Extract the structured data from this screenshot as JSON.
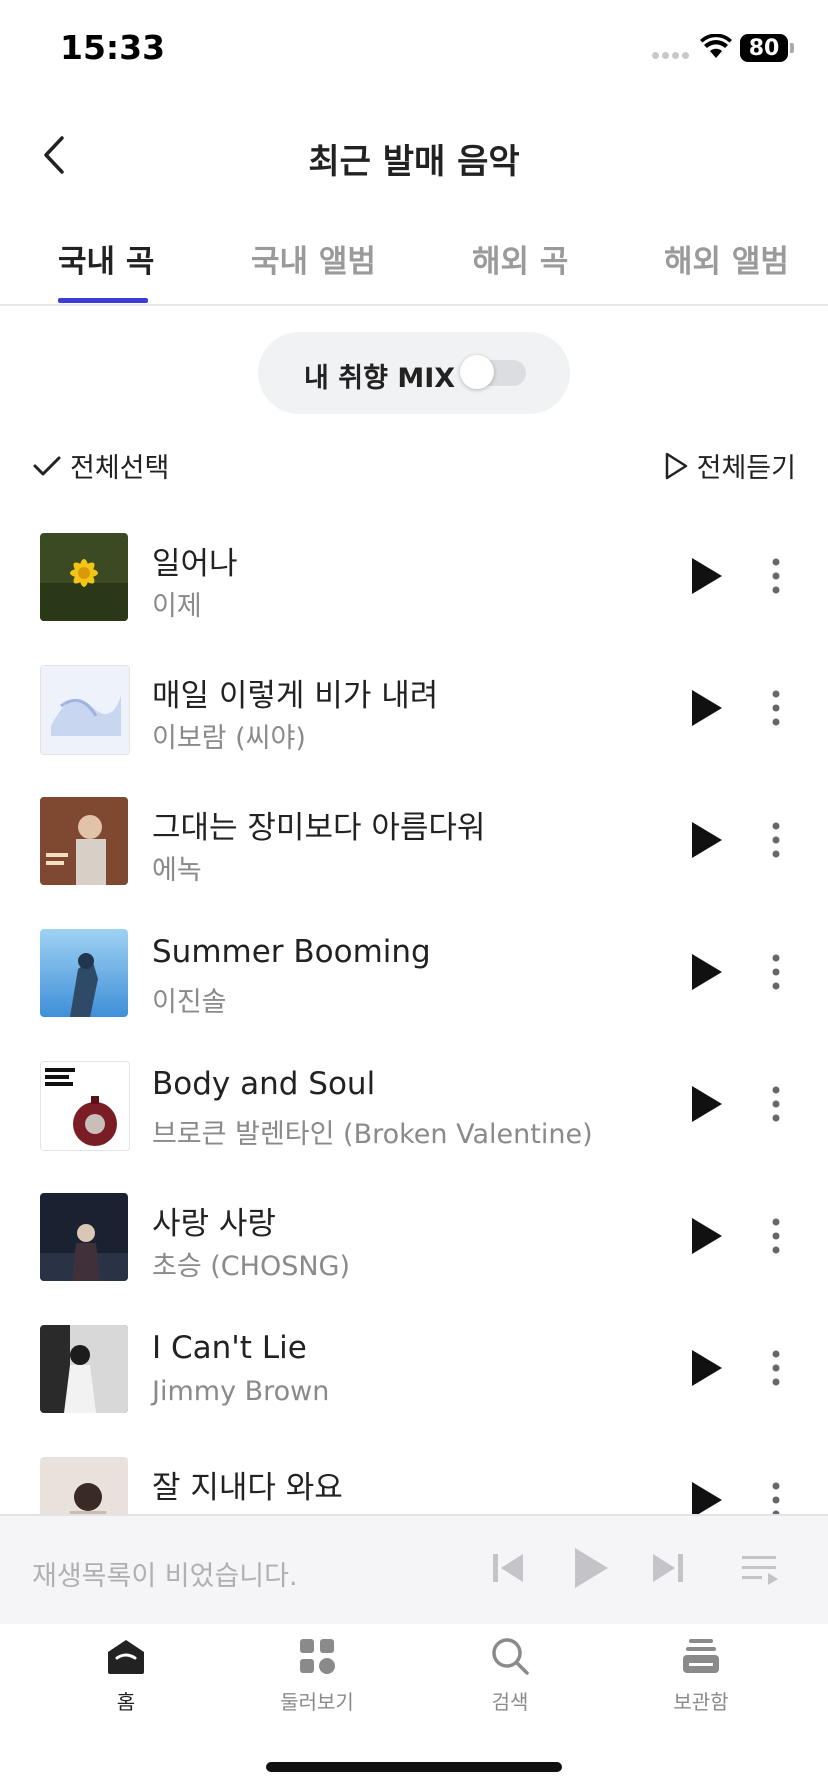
{
  "status": {
    "time": "15:33",
    "battery": "80"
  },
  "header": {
    "title": "최근 발매 음악"
  },
  "tabs": [
    {
      "label": "국내 곡",
      "active": true
    },
    {
      "label": "국내 앨범",
      "active": false
    },
    {
      "label": "해외 곡",
      "active": false
    },
    {
      "label": "해외 앨범",
      "active": false
    }
  ],
  "mix": {
    "label": "내 취향 MIX",
    "enabled": false
  },
  "actions": {
    "select_all": "전체선택",
    "listen_all": "전체듣기"
  },
  "songs": [
    {
      "title": "일어나",
      "artist": "이제"
    },
    {
      "title": "매일 이렇게 비가 내려",
      "artist": "이보람 (씨야)"
    },
    {
      "title": "그대는 장미보다 아름다워",
      "artist": "에녹"
    },
    {
      "title": "Summer Booming",
      "artist": "이진솔"
    },
    {
      "title": "Body and Soul",
      "artist": "브로큰 발렌타인 (Broken Valentine)"
    },
    {
      "title": "사랑 사랑",
      "artist": "초승 (CHOSNG)"
    },
    {
      "title": "I Can't Lie",
      "artist": "Jimmy Brown"
    },
    {
      "title": "잘 지내다 와요",
      "artist": ""
    }
  ],
  "player": {
    "empty_text": "재생목록이 비었습니다."
  },
  "nav": [
    {
      "label": "홈",
      "icon": "home-icon",
      "active": true
    },
    {
      "label": "둘러보기",
      "icon": "browse-icon",
      "active": false
    },
    {
      "label": "검색",
      "icon": "search-icon",
      "active": false
    },
    {
      "label": "보관함",
      "icon": "library-icon",
      "active": false
    }
  ],
  "colors": {
    "accent": "#3d3dd6",
    "text": "#222222",
    "muted": "#8a8a8a"
  }
}
